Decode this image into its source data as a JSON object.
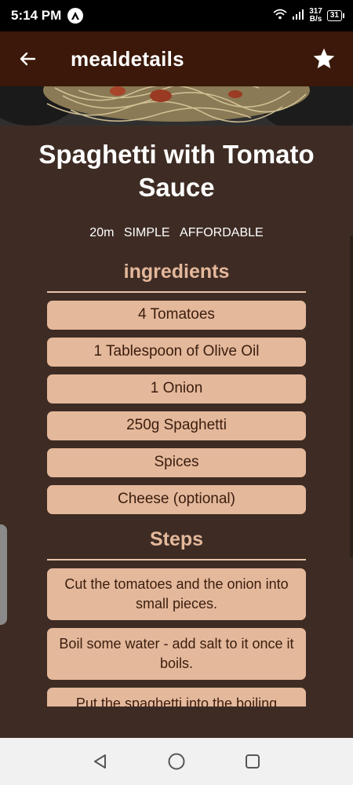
{
  "status_bar": {
    "time": "5:14 PM",
    "net_speed_value": "317",
    "net_speed_unit": "B/s",
    "battery": "31"
  },
  "app_bar": {
    "title": "mealdetails",
    "back_icon": "arrow-left-icon",
    "favorite_icon": "star-icon"
  },
  "meal": {
    "title": "Spaghetti with Tomato Sauce",
    "duration": "20m",
    "complexity": "SIMPLE",
    "affordability": "AFFORDABLE"
  },
  "ingredients": {
    "heading": "ingredients",
    "items": [
      "4 Tomatoes",
      "1 Tablespoon of Olive Oil",
      "1 Onion",
      "250g Spaghetti",
      "Spices",
      "Cheese (optional)"
    ]
  },
  "steps": {
    "heading": "Steps",
    "items": [
      "Cut the tomatoes and the onion into small pieces.",
      "Boil some water - add salt to it once it boils.",
      "Put the spaghetti into the boiling"
    ]
  },
  "colors": {
    "app_bar": "#3b1809",
    "background": "#3e2c24",
    "accent": "#e4b89b",
    "item_text": "#3a1d0e"
  },
  "nav": {
    "back_icon": "triangle-back-icon",
    "home_icon": "circle-home-icon",
    "recents_icon": "square-recents-icon"
  }
}
